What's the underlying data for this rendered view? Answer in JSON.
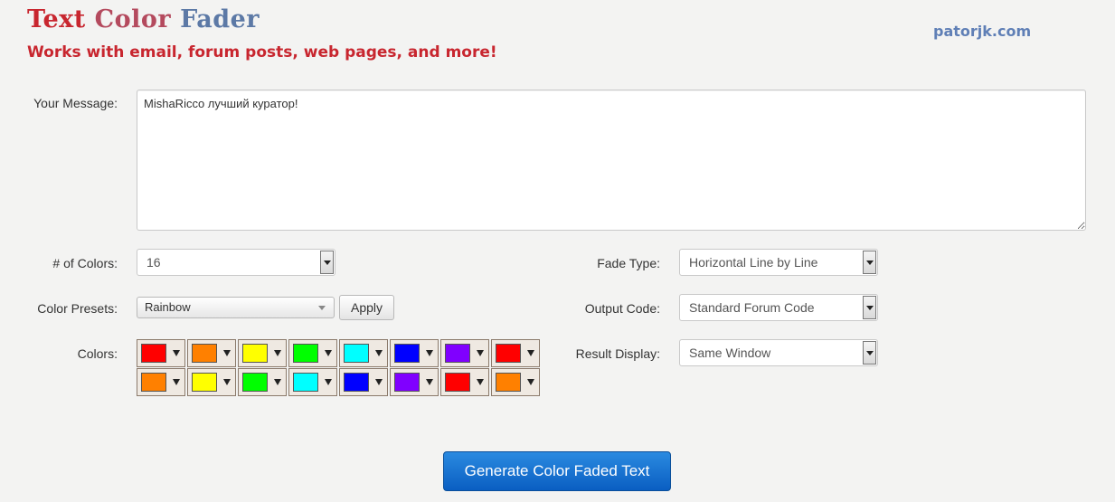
{
  "header": {
    "title_word1": "Text",
    "title_word2": "Color",
    "title_word3": "Fader",
    "subtitle": "Works with email, forum posts, web pages, and more!",
    "site_link": "patorjk.com"
  },
  "form": {
    "message_label": "Your Message:",
    "message_value": "MishaRicco лучший куратор!",
    "num_colors_label": "# of Colors:",
    "num_colors_value": "16",
    "presets_label": "Color Presets:",
    "presets_value": "Rainbow",
    "apply_label": "Apply",
    "colors_label": "Colors:",
    "fade_type_label": "Fade Type:",
    "fade_type_value": "Horizontal Line by Line",
    "output_code_label": "Output Code:",
    "output_code_value": "Standard Forum Code",
    "result_display_label": "Result Display:",
    "result_display_value": "Same Window"
  },
  "colors": [
    "#ff0000",
    "#ff8000",
    "#ffff00",
    "#00ff00",
    "#00ffff",
    "#0000ff",
    "#8000ff",
    "#ff0000",
    "#ff8000",
    "#ffff00",
    "#00ff00",
    "#00ffff",
    "#0000ff",
    "#8000ff",
    "#ff0000",
    "#ff8000"
  ],
  "generate_button": "Generate Color Faded Text",
  "icons": {
    "select_arrow": "chevron-down-icon",
    "swatch_dropdown": "triangle-down-icon"
  }
}
